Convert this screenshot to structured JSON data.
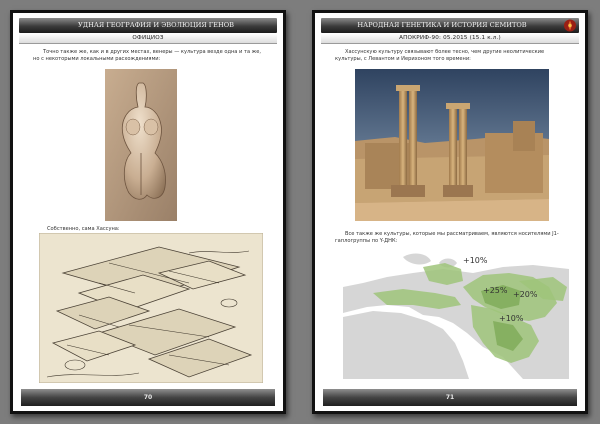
{
  "left_page": {
    "header": "УДНАЯ ГЕОГРАФИЯ И ЭВОЛЮЦИЯ ГЕНОВ",
    "section": "ОФИЦИОЗ",
    "paragraph": "Точно также же, как и в других местах, венеры — культура везде одна и та же, но с некоторыми локальными расхождениями:",
    "caption": "Собственно, сама Хассуна:",
    "page_number": "70"
  },
  "right_page": {
    "header": "НАРОДНАЯ ГЕНЕТИКА И ИСТОРИЯ СЕМИТОВ",
    "section": "АПОКРИФ-90: 05.2015 (15.1 к.л.)",
    "paragraph": "Хассунскую культуру связывают более тесно, чем другие неолитические культуры, с Левантом и Иерихоном того времени:",
    "caption": "Все также же культуры, которые мы рассматриваем, являются носителями J1-гаплогруппы по Y-ДНК:",
    "page_number": "71",
    "map_labels": [
      "+10%",
      "+25%",
      "+20%",
      "+10%"
    ]
  },
  "colors": {
    "header_band": "#3b3b3b",
    "footer_band": "#444444",
    "map_land": "#d6d6d6",
    "map_sea": "#ffffff",
    "map_distribution": "#9fc47a"
  },
  "icons": {
    "logo": "red-emblem-icon"
  }
}
